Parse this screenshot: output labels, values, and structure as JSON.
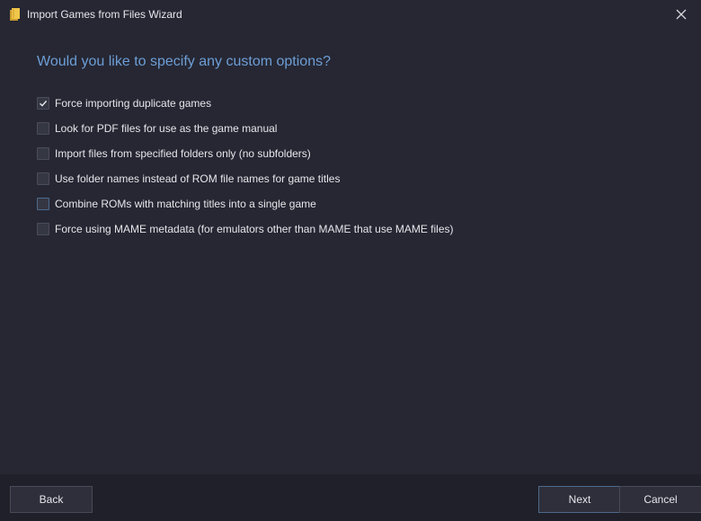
{
  "window": {
    "title": "Import Games from Files Wizard",
    "icon": "folder-icon",
    "close_icon": "close-icon"
  },
  "heading": "Would you like to specify any custom options?",
  "colors": {
    "background": "#262733",
    "footer": "#1f2029",
    "heading": "#6d9ed6",
    "accent_border": "#4e6a8d"
  },
  "options": [
    {
      "label": "Force importing duplicate games",
      "checked": true
    },
    {
      "label": "Look for PDF files for use as the game manual",
      "checked": false
    },
    {
      "label": "Import files from specified folders only (no subfolders)",
      "checked": false
    },
    {
      "label": "Use folder names instead of ROM file names for game titles",
      "checked": false
    },
    {
      "label": "Combine ROMs with matching titles into a single game",
      "checked": false
    },
    {
      "label": "Force using MAME metadata (for emulators other than MAME that use MAME files)",
      "checked": false
    }
  ],
  "footer": {
    "back_label": "Back",
    "next_label": "Next",
    "cancel_label": "Cancel"
  }
}
